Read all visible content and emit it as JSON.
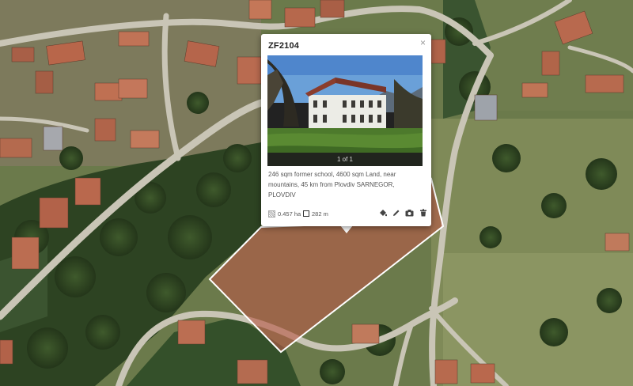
{
  "popup": {
    "title": "ZF2104",
    "close_glyph": "×",
    "photo_counter": "1 of 1",
    "description": "246 sqm former school, 4600 sqm Land, near mountains, 45 km from Plovdiv SARNEGOR, PLOVDIV",
    "area": "0.457 ha",
    "perimeter": "282 m",
    "actions": [
      "paint-bucket-icon",
      "pencil-icon",
      "camera-icon",
      "trash-icon"
    ]
  },
  "map": {
    "parcel_fill": "#b85b48",
    "parcel_stroke": "#ffffff"
  }
}
